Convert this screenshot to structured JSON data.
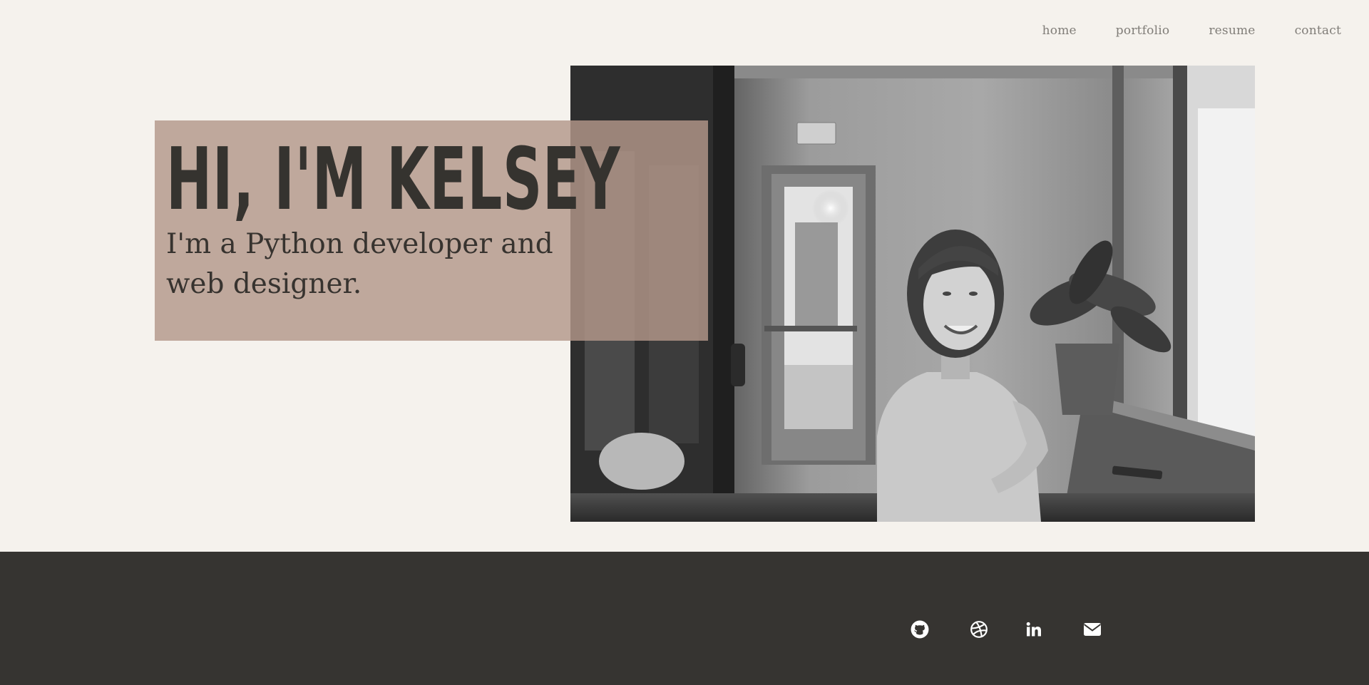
{
  "nav": {
    "items": [
      {
        "label": "home"
      },
      {
        "label": "portfolio"
      },
      {
        "label": "resume"
      },
      {
        "label": "contact"
      }
    ]
  },
  "hero": {
    "heading": "HI, I'M KELSEY",
    "subheading": "I'm a Python developer and web designer.",
    "photo_icon": "portrait-photo"
  },
  "footer": {
    "social": [
      {
        "icon": "github-icon"
      },
      {
        "icon": "dribbble-icon"
      },
      {
        "icon": "linkedin-icon"
      },
      {
        "icon": "email-icon"
      }
    ]
  },
  "colors": {
    "background": "#f5f2ed",
    "accent_box": "#b3978a",
    "text_dark": "#35332f",
    "footer": "#363431",
    "nav_text": "#807d78"
  }
}
